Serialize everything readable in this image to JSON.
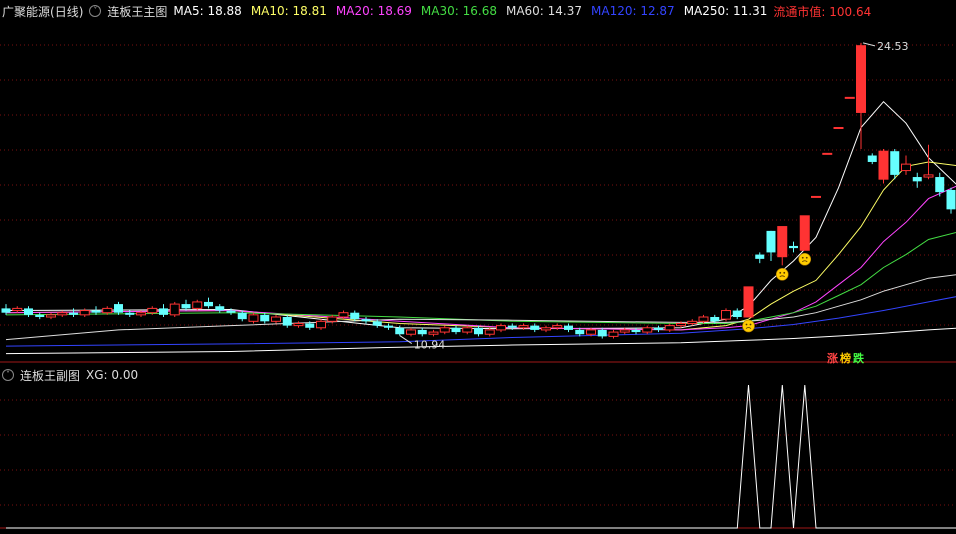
{
  "header": {
    "stock": "广聚能源",
    "period": "(日线)",
    "indicator": "连板王主图",
    "ma_items": [
      {
        "label": "MA5: 18.88",
        "color": "#ffffff"
      },
      {
        "label": "MA10: 18.81",
        "color": "#ffff66"
      },
      {
        "label": "MA20: 18.69",
        "color": "#ff44ff"
      },
      {
        "label": "MA30: 16.68",
        "color": "#44dd44"
      },
      {
        "label": "MA60: 14.37",
        "color": "#dddddd"
      },
      {
        "label": "MA120: 12.87",
        "color": "#3344ff"
      },
      {
        "label": "MA250: 11.31",
        "color": "#ffffff"
      }
    ],
    "market_cap": "流通市值: 100.64",
    "market_cap_color": "#ff3333"
  },
  "sub": {
    "indicator": "连板王副图",
    "value": "XG: 0.00"
  },
  "tag": [
    {
      "text": "涨",
      "color": "#ff4444"
    },
    {
      "text": "榜",
      "color": "#ffcc00"
    },
    {
      "text": "跌",
      "color": "#44ff44"
    }
  ],
  "chart_data": {
    "type": "candlestick",
    "high_label": "24.53",
    "low_label": "10.94",
    "up_color": "#ff3333",
    "down_color": "#66ffff",
    "ylim": [
      10.5,
      25.5
    ],
    "candles": [
      [
        12.2,
        12.0,
        12.4,
        11.9
      ],
      [
        12.1,
        12.2,
        12.3,
        12.0
      ],
      [
        12.2,
        11.9,
        12.3,
        11.8
      ],
      [
        11.9,
        11.8,
        12.0,
        11.7
      ],
      [
        11.8,
        11.9,
        12.0,
        11.7
      ],
      [
        11.9,
        12.0,
        12.1,
        11.8
      ],
      [
        12.0,
        11.9,
        12.2,
        11.8
      ],
      [
        11.9,
        12.1,
        12.2,
        11.8
      ],
      [
        12.1,
        12.0,
        12.3,
        11.9
      ],
      [
        12.0,
        12.2,
        12.3,
        11.9
      ],
      [
        12.4,
        12.0,
        12.5,
        11.9
      ],
      [
        12.0,
        11.9,
        12.1,
        11.8
      ],
      [
        11.9,
        12.0,
        12.1,
        11.8
      ],
      [
        12.0,
        12.2,
        12.3,
        11.9
      ],
      [
        12.2,
        11.9,
        12.4,
        11.8
      ],
      [
        11.9,
        12.4,
        12.5,
        11.8
      ],
      [
        12.4,
        12.2,
        12.6,
        12.1
      ],
      [
        12.2,
        12.5,
        12.6,
        12.1
      ],
      [
        12.5,
        12.3,
        12.7,
        12.2
      ],
      [
        12.3,
        12.1,
        12.4,
        12.0
      ],
      [
        12.1,
        12.0,
        12.2,
        11.9
      ],
      [
        12.0,
        11.7,
        12.1,
        11.6
      ],
      [
        11.6,
        11.9,
        12.0,
        11.5
      ],
      [
        11.9,
        11.6,
        12.0,
        11.5
      ],
      [
        11.6,
        11.8,
        11.9,
        11.5
      ],
      [
        11.8,
        11.4,
        11.9,
        11.3
      ],
      [
        11.4,
        11.5,
        11.6,
        11.3
      ],
      [
        11.5,
        11.3,
        11.6,
        11.2
      ],
      [
        11.3,
        11.6,
        11.7,
        11.2
      ],
      [
        11.6,
        11.8,
        11.9,
        11.5
      ],
      [
        11.8,
        12.0,
        12.1,
        11.7
      ],
      [
        12.0,
        11.7,
        12.1,
        11.6
      ],
      [
        11.7,
        11.6,
        11.8,
        11.5
      ],
      [
        11.6,
        11.4,
        11.7,
        11.3
      ],
      [
        11.4,
        11.3,
        11.5,
        11.2
      ],
      [
        11.3,
        11.0,
        11.4,
        10.94
      ],
      [
        11.0,
        11.2,
        11.3,
        10.9
      ],
      [
        11.2,
        11.0,
        11.3,
        10.9
      ],
      [
        11.0,
        11.1,
        11.2,
        10.9
      ],
      [
        11.1,
        11.3,
        11.4,
        11.0
      ],
      [
        11.3,
        11.1,
        11.4,
        11.0
      ],
      [
        11.1,
        11.3,
        11.4,
        11.0
      ],
      [
        11.3,
        11.0,
        11.4,
        10.9
      ],
      [
        11.0,
        11.2,
        11.3,
        10.9
      ],
      [
        11.2,
        11.4,
        11.5,
        11.1
      ],
      [
        11.4,
        11.3,
        11.5,
        11.2
      ],
      [
        11.3,
        11.4,
        11.5,
        11.2
      ],
      [
        11.4,
        11.2,
        11.5,
        11.1
      ],
      [
        11.2,
        11.3,
        11.4,
        11.1
      ],
      [
        11.3,
        11.4,
        11.5,
        11.2
      ],
      [
        11.4,
        11.2,
        11.5,
        11.1
      ],
      [
        11.2,
        11.0,
        11.3,
        10.9
      ],
      [
        11.0,
        11.2,
        11.3,
        10.9
      ],
      [
        11.2,
        10.9,
        11.3,
        10.8
      ],
      [
        10.9,
        11.1,
        11.2,
        10.8
      ],
      [
        11.1,
        11.2,
        11.3,
        11.0
      ],
      [
        11.2,
        11.1,
        11.3,
        11.0
      ],
      [
        11.1,
        11.3,
        11.4,
        11.0
      ],
      [
        11.3,
        11.2,
        11.4,
        11.1
      ],
      [
        11.2,
        11.4,
        11.5,
        11.1
      ],
      [
        11.4,
        11.5,
        11.6,
        11.3
      ],
      [
        11.5,
        11.6,
        11.7,
        11.4
      ],
      [
        11.6,
        11.8,
        11.9,
        11.5
      ],
      [
        11.8,
        11.6,
        11.9,
        11.5
      ],
      [
        11.7,
        12.1,
        12.2,
        11.6
      ],
      [
        12.1,
        11.8,
        12.2,
        11.7
      ],
      [
        11.8,
        13.2,
        13.2,
        11.8
      ],
      [
        14.7,
        14.5,
        14.8,
        14.3
      ],
      [
        15.8,
        14.8,
        15.8,
        14.4
      ],
      [
        14.6,
        16.0,
        16.0,
        14.2
      ],
      [
        15.1,
        15.0,
        15.3,
        14.8
      ],
      [
        14.9,
        16.5,
        16.5,
        14.9
      ],
      [
        17.4,
        17.4,
        17.4,
        17.4
      ],
      [
        19.4,
        19.4,
        19.4,
        19.4
      ],
      [
        20.6,
        20.6,
        20.6,
        20.6
      ],
      [
        22.0,
        22.0,
        22.0,
        22.0
      ],
      [
        21.3,
        24.4,
        24.53,
        19.6
      ],
      [
        19.3,
        19.0,
        19.4,
        18.9
      ],
      [
        18.2,
        19.5,
        19.6,
        18.0
      ],
      [
        19.5,
        18.4,
        19.6,
        18.2
      ],
      [
        18.6,
        18.9,
        19.3,
        18.4
      ],
      [
        18.3,
        18.1,
        18.5,
        17.8
      ],
      [
        18.3,
        18.4,
        19.8,
        18.2
      ],
      [
        18.3,
        17.6,
        18.5,
        17.4
      ],
      [
        17.7,
        16.8,
        17.8,
        16.6
      ],
      [
        16.9,
        16.7,
        17.1,
        16.4
      ]
    ],
    "ma_series": [
      {
        "name": "MA5",
        "color": "#ffffff",
        "values": [
          [
            0,
            12.1
          ],
          [
            20,
            12.15
          ],
          [
            35,
            11.3
          ],
          [
            45,
            11.25
          ],
          [
            60,
            11.3
          ],
          [
            64,
            11.7
          ],
          [
            66,
            12.3
          ],
          [
            68,
            13.5
          ],
          [
            70,
            14.4
          ],
          [
            72,
            15.5
          ],
          [
            74,
            17.8
          ],
          [
            76,
            20.6
          ],
          [
            78,
            21.8
          ],
          [
            80,
            20.8
          ],
          [
            82,
            19.2
          ],
          [
            85,
            17.7
          ]
        ]
      },
      {
        "name": "MA10",
        "color": "#ffff66",
        "values": [
          [
            0,
            12.0
          ],
          [
            20,
            12.1
          ],
          [
            35,
            11.5
          ],
          [
            45,
            11.3
          ],
          [
            60,
            11.2
          ],
          [
            64,
            11.4
          ],
          [
            66,
            11.7
          ],
          [
            68,
            12.4
          ],
          [
            70,
            13.0
          ],
          [
            72,
            13.5
          ],
          [
            74,
            14.7
          ],
          [
            76,
            16.0
          ],
          [
            78,
            17.7
          ],
          [
            80,
            18.8
          ],
          [
            82,
            19.0
          ],
          [
            85,
            18.8
          ]
        ]
      },
      {
        "name": "MA20",
        "color": "#ff44ff",
        "values": [
          [
            0,
            12.0
          ],
          [
            20,
            12.1
          ],
          [
            35,
            11.6
          ],
          [
            45,
            11.3
          ],
          [
            60,
            11.2
          ],
          [
            64,
            11.3
          ],
          [
            66,
            11.4
          ],
          [
            68,
            11.7
          ],
          [
            70,
            12.0
          ],
          [
            72,
            12.5
          ],
          [
            74,
            13.3
          ],
          [
            76,
            14.1
          ],
          [
            78,
            15.3
          ],
          [
            80,
            16.2
          ],
          [
            82,
            17.3
          ],
          [
            85,
            18.0
          ]
        ]
      },
      {
        "name": "MA30",
        "color": "#44dd44",
        "values": [
          [
            0,
            11.9
          ],
          [
            20,
            12.0
          ],
          [
            35,
            11.8
          ],
          [
            45,
            11.6
          ],
          [
            60,
            11.5
          ],
          [
            64,
            11.5
          ],
          [
            66,
            11.6
          ],
          [
            68,
            11.8
          ],
          [
            70,
            12.0
          ],
          [
            72,
            12.3
          ],
          [
            74,
            12.8
          ],
          [
            76,
            13.3
          ],
          [
            78,
            14.1
          ],
          [
            80,
            14.7
          ],
          [
            82,
            15.4
          ],
          [
            85,
            15.8
          ]
        ]
      },
      {
        "name": "MA60",
        "color": "#dddddd",
        "values": [
          [
            0,
            10.75
          ],
          [
            10,
            11.2
          ],
          [
            20,
            11.4
          ],
          [
            35,
            11.7
          ],
          [
            45,
            11.65
          ],
          [
            60,
            11.55
          ],
          [
            64,
            11.55
          ],
          [
            66,
            11.6
          ],
          [
            68,
            11.7
          ],
          [
            70,
            11.8
          ],
          [
            72,
            12.0
          ],
          [
            74,
            12.3
          ],
          [
            76,
            12.6
          ],
          [
            78,
            13.0
          ],
          [
            80,
            13.3
          ],
          [
            82,
            13.6
          ],
          [
            85,
            13.8
          ]
        ]
      },
      {
        "name": "MA120",
        "color": "#3344ff",
        "values": [
          [
            0,
            10.45
          ],
          [
            20,
            10.55
          ],
          [
            35,
            10.65
          ],
          [
            45,
            10.85
          ],
          [
            60,
            11.05
          ],
          [
            66,
            11.25
          ],
          [
            70,
            11.45
          ],
          [
            74,
            11.75
          ],
          [
            78,
            12.1
          ],
          [
            82,
            12.5
          ],
          [
            85,
            12.8
          ]
        ]
      },
      {
        "name": "MA250",
        "color": "#ffffff",
        "values": [
          [
            0,
            10.1
          ],
          [
            20,
            10.2
          ],
          [
            35,
            10.4
          ],
          [
            45,
            10.5
          ],
          [
            60,
            10.6
          ],
          [
            66,
            10.72
          ],
          [
            70,
            10.8
          ],
          [
            74,
            10.92
          ],
          [
            78,
            11.05
          ],
          [
            82,
            11.2
          ],
          [
            85,
            11.3
          ]
        ]
      }
    ],
    "smiley_idx": [
      66,
      69,
      71
    ],
    "xg": [
      0,
      0,
      0,
      0,
      0,
      0,
      0,
      0,
      0,
      0,
      0,
      0,
      0,
      0,
      0,
      0,
      0,
      0,
      0,
      0,
      0,
      0,
      0,
      0,
      0,
      0,
      0,
      0,
      0,
      0,
      0,
      0,
      0,
      0,
      0,
      0,
      0,
      0,
      0,
      0,
      0,
      0,
      0,
      0,
      0,
      0,
      0,
      0,
      0,
      0,
      0,
      0,
      0,
      0,
      0,
      0,
      0,
      0,
      0,
      0,
      0,
      0,
      0,
      0,
      0,
      0,
      1,
      0,
      0,
      1,
      0,
      1,
      0,
      0,
      0,
      0,
      0,
      0,
      0,
      0,
      0,
      0,
      0,
      0,
      0,
      0
    ]
  }
}
